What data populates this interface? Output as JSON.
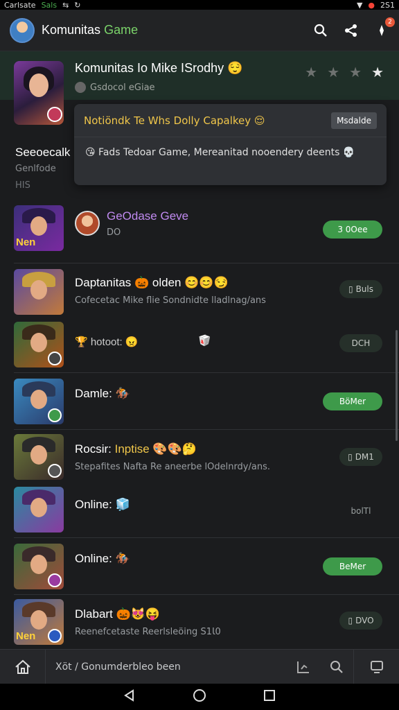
{
  "status_bar": {
    "carrier": "Carlsate",
    "app": "Sals",
    "time": "2S1"
  },
  "app_bar": {
    "title": "Komunitas",
    "title_accent": "Game",
    "notification_count": "2"
  },
  "featured": {
    "title": "Komunitas Io Mike ISrodhy 😌",
    "subtitle": "Gsdocol eGiae",
    "rating_filled": 1,
    "rating_total": 4
  },
  "side_section": {
    "title": "Seeoecalk",
    "sub1": "Genlfode",
    "sub2": "HIS"
  },
  "popup": {
    "title": "Notiöndk Te Whs Dolly Capalkey 😌",
    "button": "Msdalde",
    "body": "😘 Fads Tedoar Game, Mereanitad nooendery deents 💀"
  },
  "rows": [
    {
      "title": "GeOdase",
      "title_suffix": " Geve",
      "sub": "DO",
      "badge_tag": "Nen",
      "action": "3 0Oee",
      "action_style": "green"
    },
    {
      "title": "Daptanitas",
      "title_suffix": " 🎃 olden 😊😊😏",
      "sub": "Cofecetac Mike flie Sondnidte lladlnag/ans",
      "action": "Buls",
      "action_style": "dark"
    },
    {
      "title": "🏆 hotoot: 😠",
      "title_suffix": "",
      "sub": "",
      "extra": "🥡",
      "action": "DCH",
      "action_style": "dark"
    },
    {
      "title": "Damle: 🏇",
      "title_suffix": "",
      "sub": "",
      "action": "BöMer",
      "action_style": "green"
    },
    {
      "title": "Rocsir: ",
      "title_suffix": "Inptise 🎨🎨🤔",
      "sub": "Stepafites Nafta Re aneerbe lOdelnrdy/ans.",
      "action": "DM1",
      "action_style": "dark"
    },
    {
      "title": "Online: 🧊",
      "title_suffix": "",
      "sub": "",
      "action": "bolTl",
      "action_style": "plain"
    },
    {
      "title": "Online: 🏇",
      "title_suffix": "",
      "sub": "",
      "action": "BeMer",
      "action_style": "green"
    },
    {
      "title": "Dlabart 🎃😻😝",
      "title_suffix": "",
      "sub": "Reenefcetaste Reerlsleöing S1Ɩ0",
      "badge_tag": "Nen",
      "action": "DVO",
      "action_style": "dark"
    }
  ],
  "bottom_bar": {
    "text": "Xöt / Gonumderbleo been"
  },
  "colors": {
    "accent_green": "#3e9a4a",
    "title_green": "#7bd36a",
    "popup_yellow": "#f0c64a"
  }
}
